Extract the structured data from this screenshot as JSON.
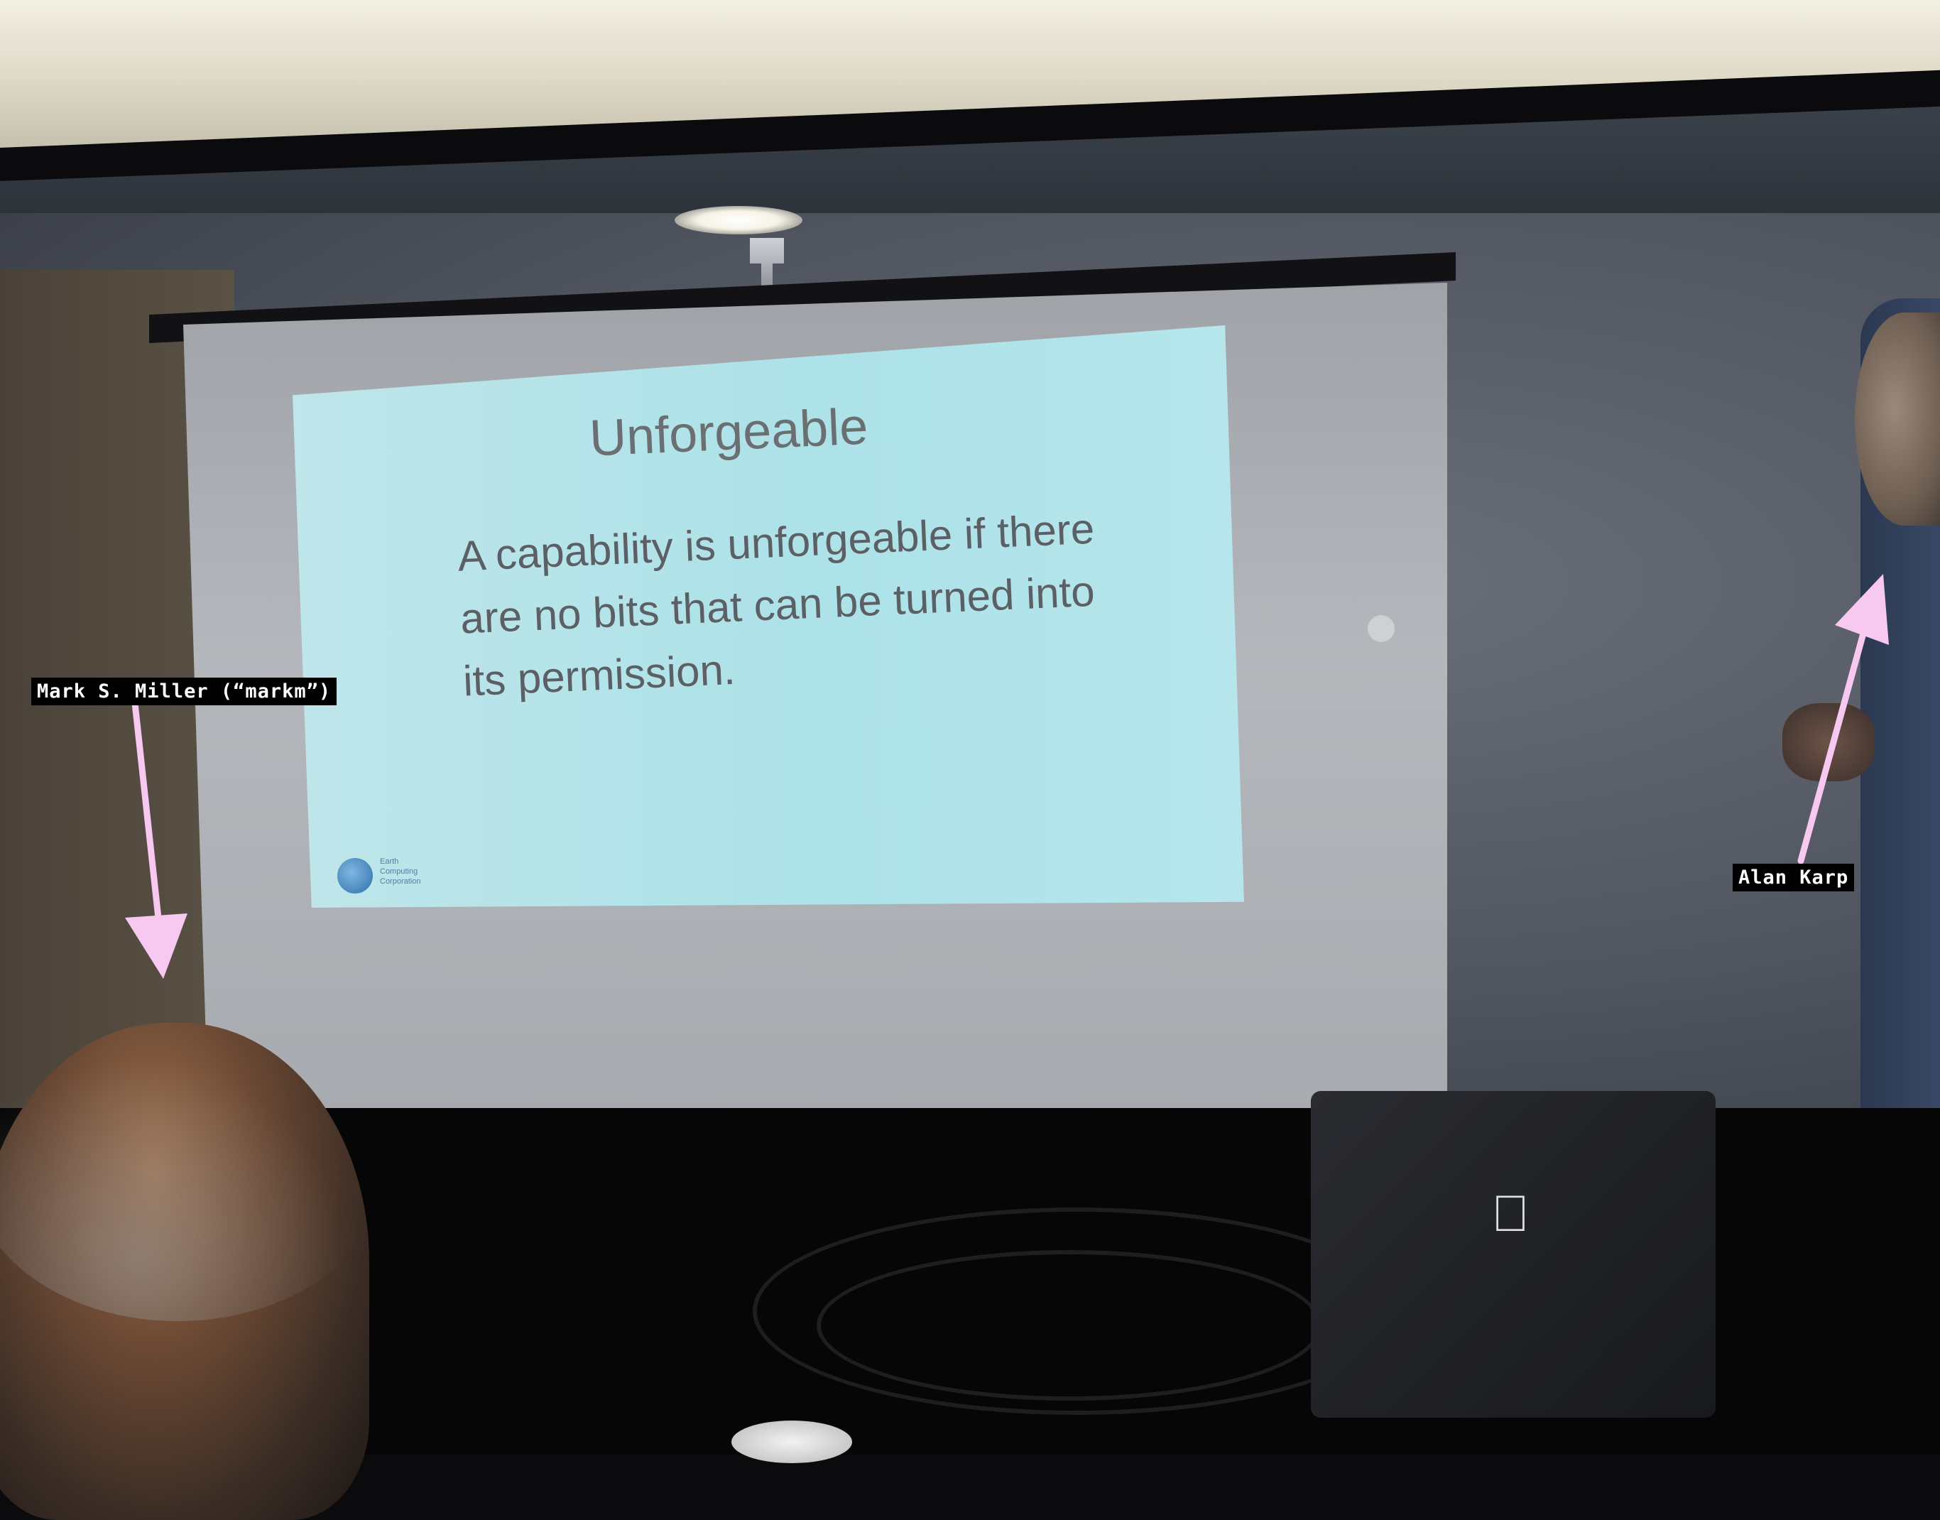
{
  "slide": {
    "title": "Unforgeable",
    "body": "A capability is unforgeable if there are no bits that can be turned into its permission.",
    "logo_text": "Earth\nComputing\nCorporation"
  },
  "annotations": {
    "left_label": "Mark S. Miller (“markm”)",
    "right_label": "Alan Karp",
    "arrow_color": "#f7c8f0"
  },
  "laptop": {
    "logo_icon": "apple-logo-icon"
  }
}
